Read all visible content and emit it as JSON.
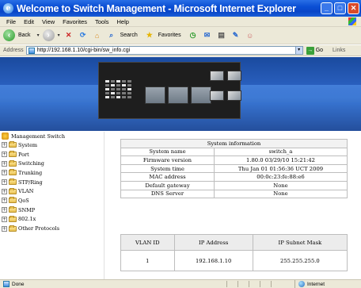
{
  "window": {
    "title": "Welcome to Switch Management - Microsoft Internet Explorer",
    "buttons": [
      "_",
      "□",
      "✕"
    ]
  },
  "menu": [
    "File",
    "Edit",
    "View",
    "Favorites",
    "Tools",
    "Help"
  ],
  "toolbar": {
    "back_label": "Back",
    "search_label": "Search",
    "favorites_label": "Favorites"
  },
  "address": {
    "label": "Address",
    "value": "http://192.168.1.10/cgi-bin/sw_info.cgi",
    "go_label": "Go",
    "links_label": "Links"
  },
  "sidebar": {
    "root": "Management Switch",
    "items": [
      {
        "label": "System"
      },
      {
        "label": "Port"
      },
      {
        "label": "Switching"
      },
      {
        "label": "Trunking"
      },
      {
        "label": "STP/Ring"
      },
      {
        "label": "VLAN"
      },
      {
        "label": "QoS"
      },
      {
        "label": "SNMP"
      },
      {
        "label": "802.1x"
      },
      {
        "label": "Other Protocols"
      }
    ]
  },
  "system_info": {
    "header": "System information",
    "rows": [
      {
        "key": "System name",
        "value": "switch_a"
      },
      {
        "key": "Firmware version",
        "value": "1.80.0 03/29/10 15:21:42"
      },
      {
        "key": "System time",
        "value": "Thu Jan 01 01:56:36 UCT 2009"
      },
      {
        "key": "MAC address",
        "value": "00:0c:23:fe:88:e6"
      },
      {
        "key": "Default gateway",
        "value": "None"
      },
      {
        "key": "DNS Server",
        "value": "None"
      }
    ]
  },
  "vlan_table": {
    "headers": [
      "VLAN ID",
      "IP Address",
      "IP Subnet Mask"
    ],
    "rows": [
      [
        "1",
        "192.168.1.10",
        "255.255.255.0"
      ]
    ]
  },
  "status": {
    "text": "Done",
    "zone": "Internet"
  }
}
